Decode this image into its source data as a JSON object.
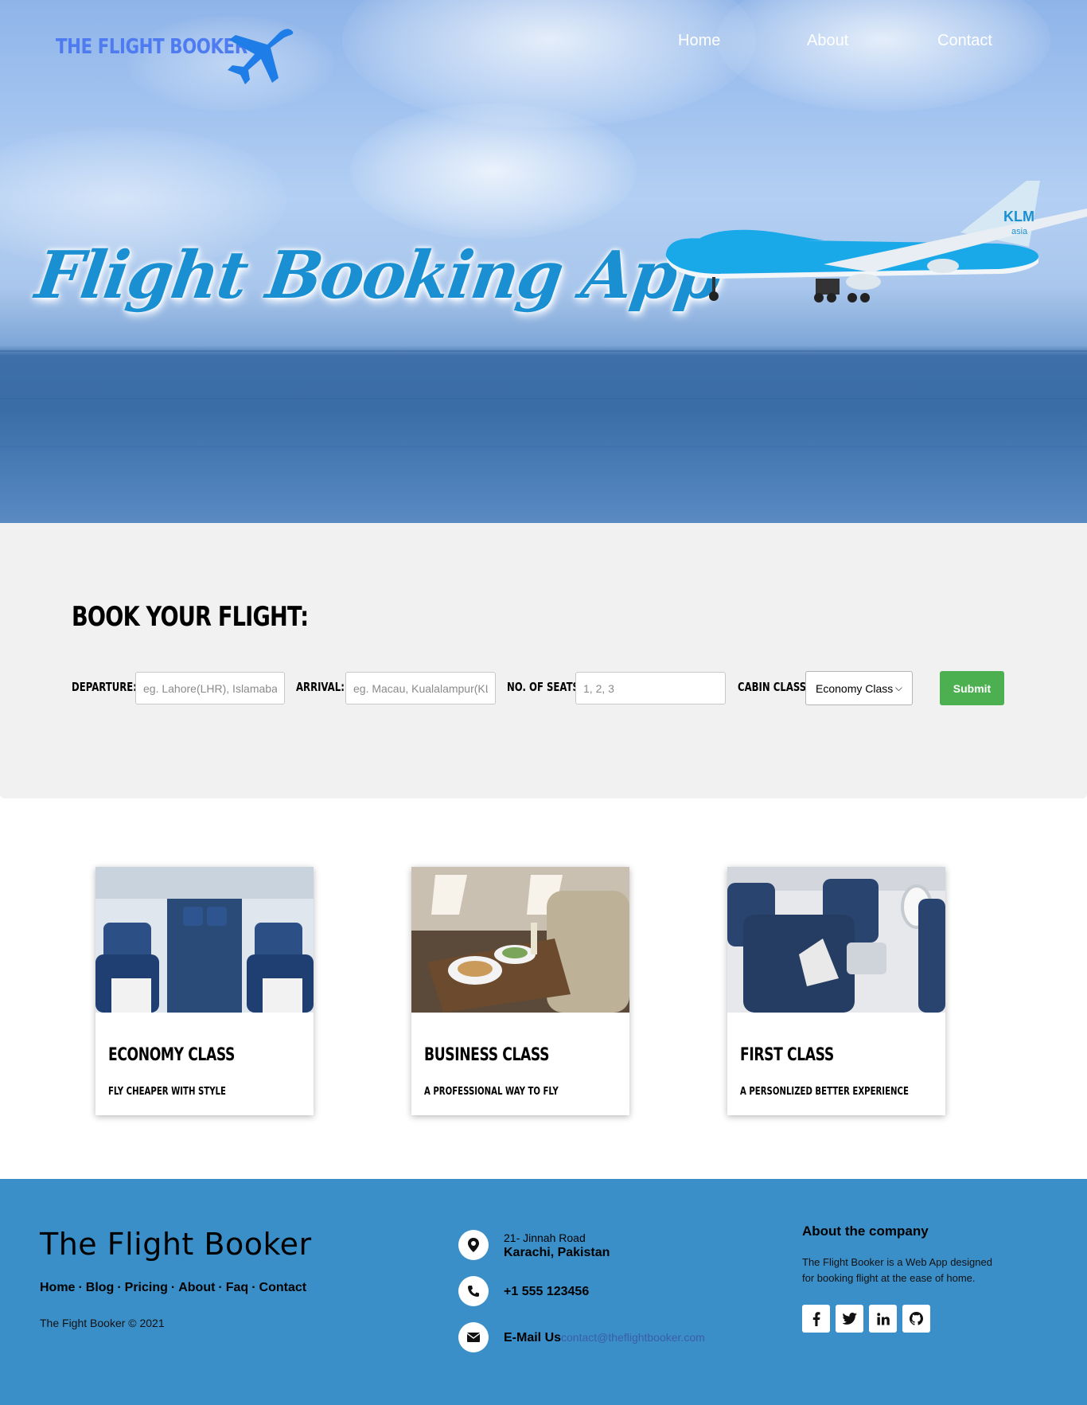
{
  "header": {
    "brand": "THE FLIGHT BOOKER",
    "nav": [
      {
        "label": "Home"
      },
      {
        "label": "About"
      },
      {
        "label": "Contact"
      }
    ]
  },
  "hero": {
    "title": "Flight Booking App",
    "jet_livery": "KLM",
    "jet_livery_sub": "asia"
  },
  "booking": {
    "heading": "BOOK YOUR FLIGHT:",
    "departure_label": "DEPARTURE:",
    "departure_placeholder": "eg. Lahore(LHR), Islamabad",
    "arrival_label": "ARRIVAL:",
    "arrival_placeholder": "eg. Macau, Kualalampur(KL)",
    "seats_label": "NO. OF SEATS:",
    "seats_placeholder": "1, 2, 3",
    "cabin_label": "CABIN CLASS:",
    "cabin_selected": "Economy Class",
    "submit_label": "Submit",
    "submit_color": "#4caf50"
  },
  "cards": [
    {
      "title": "ECONOMY CLASS",
      "subtitle": "FLY CHEAPER WITH STYLE"
    },
    {
      "title": "BUSINESS CLASS",
      "subtitle": "A PROFESSIONAL WAY TO FLY"
    },
    {
      "title": "FIRST CLASS",
      "subtitle": "A PERSONLIZED BETTER EXPERIENCE"
    }
  ],
  "footer": {
    "brand": "The Flight Booker",
    "links": [
      "Home",
      "Blog",
      "Pricing",
      "About",
      "Faq",
      "Contact"
    ],
    "copyright": "The Fight Booker © 2021",
    "address_line1": "21- Jinnah Road",
    "address_line2": "Karachi, Pakistan",
    "phone": "+1 555 123456",
    "email_label": "E-Mail Us",
    "email_value": "contact@theflightbooker.com",
    "about_heading": "About the company",
    "about_text": "The Flight Booker is a Web App designed for booking flight at the ease of home.",
    "bg_color": "#3a8fc9",
    "social_icons": [
      "facebook-icon",
      "twitter-icon",
      "linkedin-icon",
      "github-icon"
    ]
  }
}
